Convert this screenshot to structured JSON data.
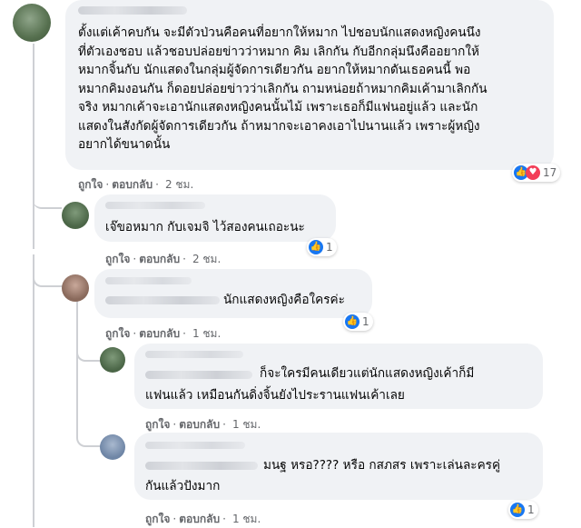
{
  "comments": [
    {
      "text": "ตั้งแต่เค้าคบกัน จะมีตัวป่วนคือคนที่อยากให้หมาก ไปชอบนักแสดงหญิงคนนึง\nที่ตัวเองชอบ แล้วชอบปล่อยข่าวว่าหมาก คิม เลิกกัน กับอีกกลุ่มนึงคืออยากให้\nหมากจิ้นกับ นักแสดงในกลุ่มผู้จัดการเดียวกัน อยากให้หมากดันเธอคนนี้ พอ\nหมากคิมงอนกัน ก็ดอยปล่อยข่าวว่าเลิกกัน ถามหน่อยถ้าหมากคิมเค้ามาเลิกกัน\nจริง หมากเค้าจะเอานักแสดงหญิงคนนั้นไม้ เพราะเธอก็มีแฟนอยู่แล้ว และนัก\nแสดงในสังกัดผู้จัดการเดียวกัน ถ้าหมากจะเอาคงเอาไปนานแล้ว เพราะผู้หญิง\nอยากได้ขนาดนั้น",
      "like": "ถูกใจ",
      "reply": "ตอบกลับ",
      "time": "2 ชม.",
      "reaction_count": "17"
    },
    {
      "text": "เจ๊ขอหมาก กับเจมจิ ไว้สองคนเถอะนะ",
      "like": "ถูกใจ",
      "reply": "ตอบกลับ",
      "time": "2 ชม.",
      "reaction_count": "1"
    },
    {
      "text": "นักแสดงหญิงคือใครค่ะ",
      "like": "ถูกใจ",
      "reply": "ตอบกลับ",
      "time": "1 ชม.",
      "reaction_count": "1"
    },
    {
      "text_line1": "ก็จะใครมีคนเดียวแต่นักแสดงหญิงเค้าก็มี",
      "text_line2": "แฟนแล้ว เหมือนกันดิ่งจิ้นยังไประรานแฟนเค้าเลย",
      "like": "ถูกใจ",
      "reply": "ตอบกลับ",
      "time": "1 ชม."
    },
    {
      "text_line1": "มนฐ หรอ???? หรือ กสภสร เพราะเล่นละครคู่",
      "text_line2": "กันแล้วปังมาก",
      "like": "ถูกใจ",
      "reply": "ตอบกลับ",
      "time": "1 ชม.",
      "reaction_count": "1"
    }
  ],
  "colors": {
    "like_blue": "#1877f2",
    "love_red": "#f33e58",
    "bubble": "#f0f2f5",
    "meta_gray": "#65676b"
  },
  "icons": [
    "like-icon",
    "love-icon"
  ],
  "separator": "·"
}
